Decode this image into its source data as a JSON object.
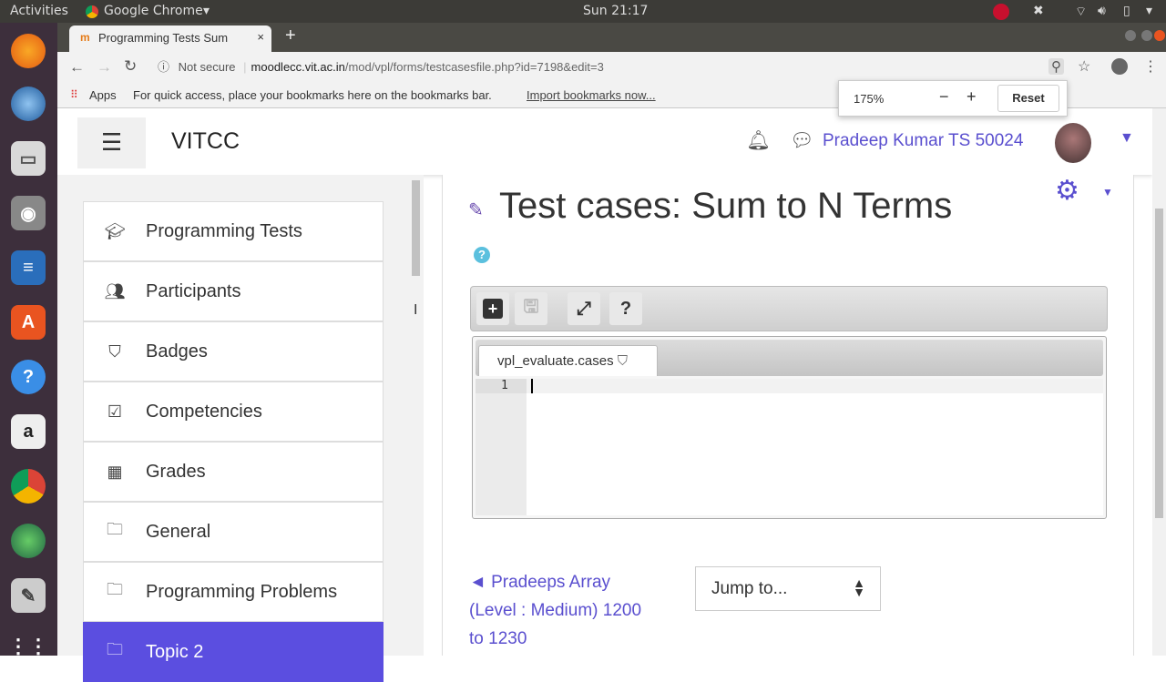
{
  "system": {
    "activities": "Activities",
    "app_menu": "Google Chrome",
    "clock": "Sun 21:17"
  },
  "browser": {
    "tab_title": "Programming Tests Sum",
    "url_secure": "Not secure",
    "url_host": "moodlecc.vit.ac.in",
    "url_path": "/mod/vpl/forms/testcasesfile.php?id=7198&edit=3",
    "apps": "Apps",
    "bookmarks_hint": "For quick access, place your bookmarks here on the bookmarks bar.",
    "import_link": "Import bookmarks now...",
    "zoom_level": "175%",
    "zoom_reset": "Reset"
  },
  "site": {
    "name": "VITCC",
    "user": "Pradeep Kumar TS 50024"
  },
  "sidebar": {
    "items": [
      {
        "label": "Programming Tests",
        "icon": "graduation-cap"
      },
      {
        "label": "Participants",
        "icon": "users"
      },
      {
        "label": "Badges",
        "icon": "shield"
      },
      {
        "label": "Competencies",
        "icon": "check-square"
      },
      {
        "label": "Grades",
        "icon": "table"
      },
      {
        "label": "General",
        "icon": "folder"
      },
      {
        "label": "Programming Problems",
        "icon": "folder"
      },
      {
        "label": "Topic 2",
        "icon": "folder"
      }
    ]
  },
  "main": {
    "title": "Test cases: Sum to N Terms",
    "file_tab": "vpl_evaluate.cases",
    "line_number": "1",
    "prev_link": "◄ Pradeeps Array (Level : Medium) 1200 to 1230",
    "jump_to": "Jump to..."
  },
  "colors": {
    "accent": "#5a4fcf",
    "active_nav": "#5b4ee0"
  }
}
